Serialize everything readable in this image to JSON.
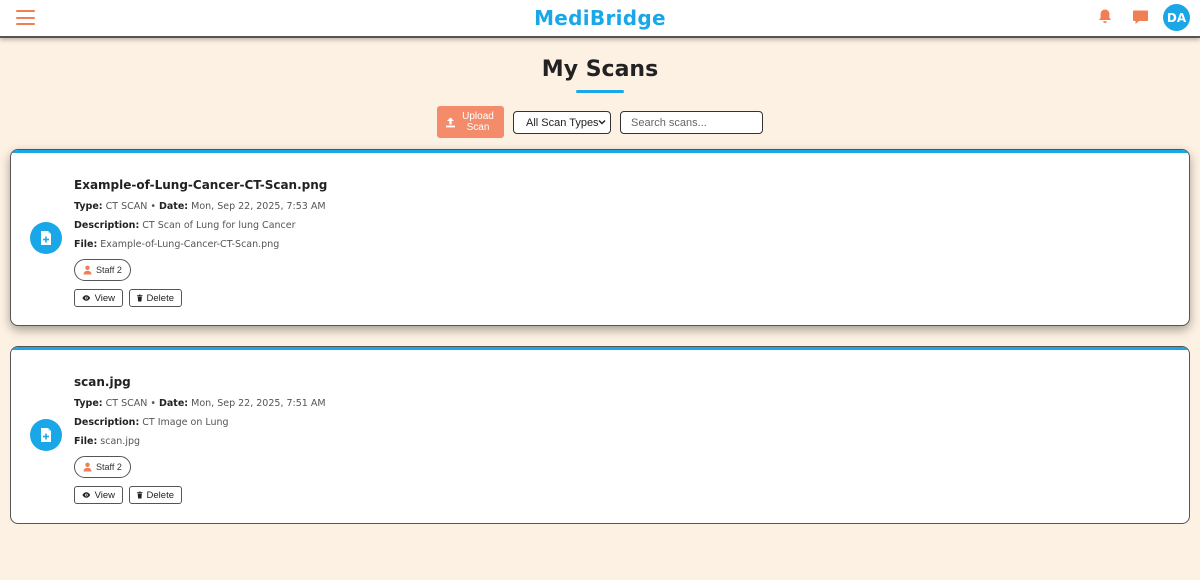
{
  "header": {
    "brand": "MediBridge",
    "avatar_initials": "DA",
    "icons": [
      "menu-icon",
      "bell-icon",
      "chat-icon"
    ],
    "accent": "#1aa7e8",
    "orange": "#f07f55"
  },
  "page": {
    "title": "My Scans"
  },
  "toolbar": {
    "upload_label": "Upload Scan",
    "type_filter_value": "All Scan Types",
    "search_placeholder": "Search scans..."
  },
  "scans": [
    {
      "name": "Example-of-Lung-Cancer-CT-Scan.png",
      "type_label": "Type:",
      "type": "CT SCAN",
      "date_label": "Date:",
      "date": "Mon, Sep 22, 2025, 7:53 AM",
      "description_label": "Description:",
      "description": "CT Scan of Lung for lung Cancer",
      "file_label": "File:",
      "file": "Example-of-Lung-Cancer-CT-Scan.png",
      "staff": "Staff 2",
      "view_label": "View",
      "delete_label": "Delete"
    },
    {
      "name": "scan.jpg",
      "type_label": "Type:",
      "type": "CT SCAN",
      "date_label": "Date:",
      "date": "Mon, Sep 22, 2025, 7:51 AM",
      "description_label": "Description:",
      "description": "CT Image on Lung",
      "file_label": "File:",
      "file": "scan.jpg",
      "staff": "Staff 2",
      "view_label": "View",
      "delete_label": "Delete"
    }
  ]
}
